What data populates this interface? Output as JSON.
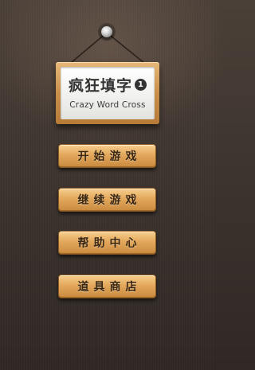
{
  "sign": {
    "title": "疯狂填字",
    "level_badge": "1",
    "subtitle": "Crazy Word Cross"
  },
  "menu": {
    "items": [
      {
        "label": "开始游戏"
      },
      {
        "label": "继续游戏"
      },
      {
        "label": "帮助中心"
      },
      {
        "label": "道具商店"
      }
    ]
  },
  "colors": {
    "background": "#3f352f",
    "wood": "#e3a85c",
    "sign_text": "#333333",
    "button_text": "#3a2713"
  }
}
